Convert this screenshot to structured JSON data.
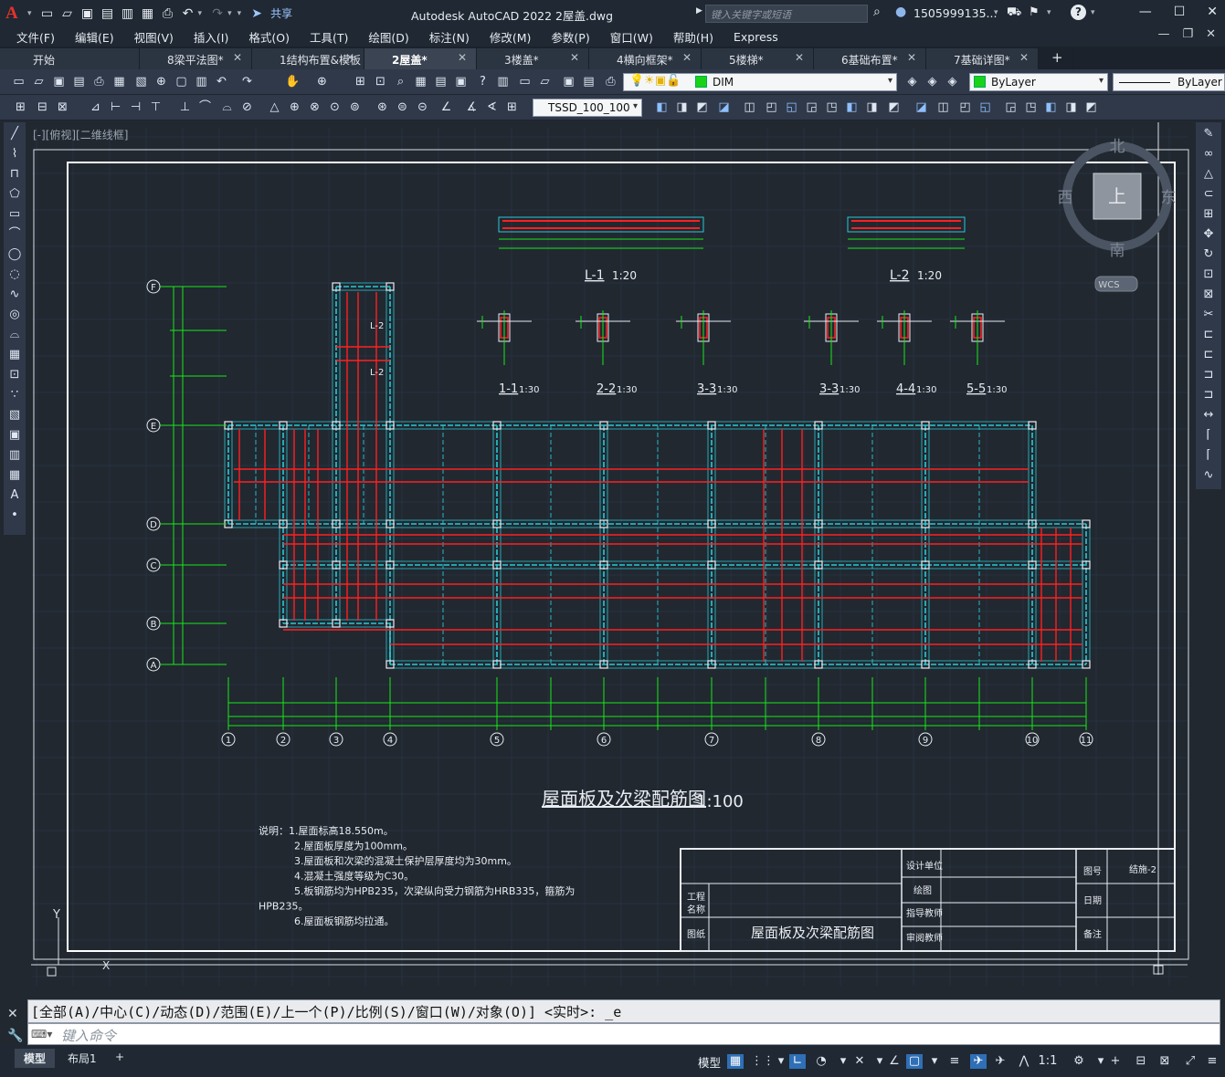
{
  "titlebar": {
    "app_letter": "A",
    "share": "共享",
    "title": "Autodesk AutoCAD 2022    2屋盖.dwg",
    "search_placeholder": "键入关键字或短语",
    "user": "1505999135...",
    "minimize": "—",
    "maximize": "☐",
    "close": "✕"
  },
  "menus": [
    "文件(F)",
    "编辑(E)",
    "视图(V)",
    "插入(I)",
    "格式(O)",
    "工具(T)",
    "绘图(D)",
    "标注(N)",
    "修改(M)",
    "参数(P)",
    "窗口(W)",
    "帮助(H)",
    "Express"
  ],
  "tabs": [
    {
      "label": "开始"
    },
    {
      "label": "8梁平法图*"
    },
    {
      "label": "1结构布置&模板"
    },
    {
      "label": "2屋盖*"
    },
    {
      "label": "3楼盖*"
    },
    {
      "label": "4横向框架*"
    },
    {
      "label": "5楼梯*"
    },
    {
      "label": "6基础布置*"
    },
    {
      "label": "7基础详图*"
    }
  ],
  "tab_close": "✕",
  "tab_add": "+",
  "toolbar": {
    "layer": "DIM",
    "color": "ByLayer",
    "linetype": "ByLayer",
    "dimstyle": "TSSD_100_100"
  },
  "viewport": {
    "label": "[-][俯视][二维线框]"
  },
  "viewcube": {
    "north": "北",
    "south": "南",
    "east": "东",
    "west": "西",
    "top": "上",
    "wcs": "WCS"
  },
  "drawing": {
    "title": "屋面板及次梁配筋图",
    "scale": "1:100",
    "axes_x": [
      "1",
      "2",
      "3",
      "4",
      "5",
      "6",
      "7",
      "8",
      "9",
      "10",
      "11"
    ],
    "axes_y": [
      "F",
      "E",
      "D",
      "C",
      "B",
      "A"
    ],
    "sections_top": [
      {
        "label": "L-1",
        "scale": "1:20"
      },
      {
        "label": "L-2",
        "scale": "1:20"
      }
    ],
    "sections": [
      {
        "label": "1-1",
        "scale": "1:30"
      },
      {
        "label": "2-2",
        "scale": "1:30"
      },
      {
        "label": "3-3",
        "scale": "1:30"
      },
      {
        "label": "3-3",
        "scale": "1:30"
      },
      {
        "label": "4-4",
        "scale": "1:30"
      },
      {
        "label": "5-5",
        "scale": "1:30"
      }
    ],
    "beam_tags": [
      "L-2",
      "L-2"
    ],
    "notes": [
      "说明：1.屋面标高18.550m。",
      "2.屋面板厚度为100mm。",
      "3.屋面板和次梁的混凝土保护层厚度均为30mm。",
      "4.混凝土强度等级为C30。",
      "5.板钢筋均为HPB235，次梁纵向受力钢筋为HRB335，箍筋为",
      "HPB235。",
      "6.屋面板钢筋均拉通。"
    ],
    "titleblock": {
      "design_unit": "设计单位",
      "drawing": "绘图",
      "instructor": "指导教师",
      "reviewer": "审阅教师",
      "project": "工程",
      "project2": "名称",
      "sheet": "图纸",
      "sheet_title": "屋面板及次梁配筋图",
      "number": "图号",
      "number_value": "结施-2",
      "date": "日期",
      "remark": "备注"
    }
  },
  "command": {
    "prompt": "[全部(A)/中心(C)/动态(D)/范围(E)/上一个(P)/比例(S)/窗口(W)/对象(O)] <实时>: _e",
    "placeholder": "键入命令"
  },
  "statusbar": {
    "layouts": [
      "模型",
      "布局1"
    ],
    "add": "+",
    "model": "模型",
    "scale": "1:1"
  },
  "colors": {
    "axis": "#29c9d6",
    "grid": "#17e817",
    "rebar": "#ff2020",
    "frame": "#ffffff",
    "bg": "#212830"
  }
}
